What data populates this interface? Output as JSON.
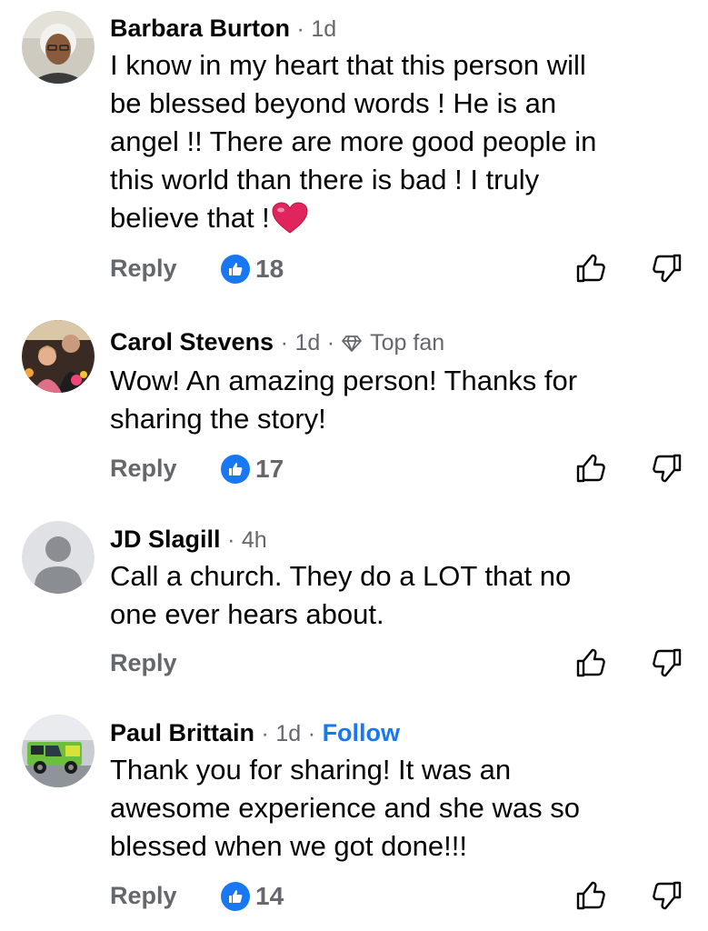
{
  "comments": [
    {
      "author": "Barbara Burton",
      "time": "1d",
      "text": "I know in my heart that this person will be blessed beyond words ! He is an angel !! There are more good people in this world than there is bad ! I truly believe that !",
      "text_lines": [
        "I know in my heart that this person will",
        "be blessed beyond words ! He is an",
        "angel !! There are more good people in",
        "this world than there is bad ! I truly",
        "believe that !"
      ],
      "emoji": "red-heart",
      "reply_label": "Reply",
      "likes": "18"
    },
    {
      "author": "Carol Stevens",
      "time": "1d",
      "badge": "Top fan",
      "text_lines": [
        "Wow! An amazing person! Thanks for",
        "sharing the story!"
      ],
      "reply_label": "Reply",
      "likes": "17"
    },
    {
      "author": "JD Slagill",
      "time": "4h",
      "text_lines": [
        "Call a church. They do a LOT that no",
        "one ever hears about."
      ],
      "reply_label": "Reply"
    },
    {
      "author": "Paul Brittain",
      "time": "1d",
      "follow_label": "Follow",
      "text_lines": [
        "Thank you for sharing! It was an",
        "awesome experience and she was so",
        "blessed when we got done!!!"
      ],
      "reply_label": "Reply",
      "likes": "14"
    }
  ],
  "separator": "·",
  "colors": {
    "like_blue": "#1877f2",
    "secondary_text": "#65676b",
    "primary_text": "#050505",
    "heart_red": "#e0245e"
  }
}
